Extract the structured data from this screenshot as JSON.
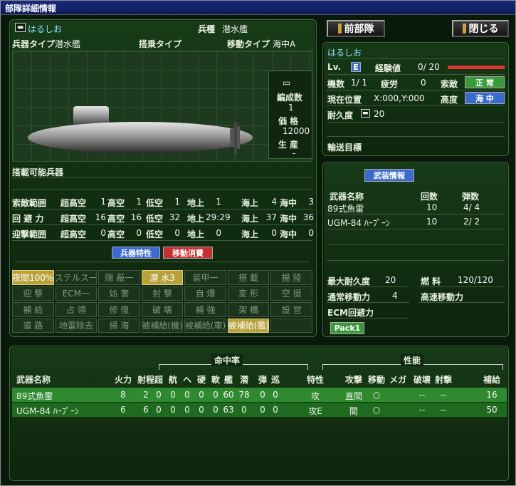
{
  "window": {
    "title": "部隊詳細情報"
  },
  "unit": {
    "name": "はるしお",
    "type_label": "兵種",
    "type_value": "潜水艦",
    "weapon_type_label": "兵器タイプ",
    "weapon_type_value": "潜水艦",
    "transport_label": "搭乗タイプ",
    "transport_value": "",
    "move_label": "移動タイプ",
    "move_value": "海中A"
  },
  "side": {
    "formation_label": "編成数",
    "formation_value": "1",
    "price_label": "価 格",
    "price_value": "12000",
    "produce_label": "生 産",
    "produce_value": "-"
  },
  "loadable": {
    "label": "搭載可能兵器"
  },
  "ranges": {
    "rows": [
      {
        "label": "索敵範囲",
        "v": [
          "1",
          "1",
          "1",
          "1",
          "4",
          "3"
        ]
      },
      {
        "label": "回 避 力",
        "v": [
          "16",
          "16",
          "32",
          "29:29",
          "37",
          "36"
        ]
      },
      {
        "label": "迎撃範囲",
        "v": [
          "0",
          "0",
          "0",
          "0",
          "0",
          "0"
        ]
      }
    ],
    "cols": [
      "超高空",
      "高空",
      "低空",
      "地上",
      "海上",
      "海中"
    ]
  },
  "tabs": {
    "traits": "兵器特性",
    "move_cost": "移動消費"
  },
  "traits": [
    "夜間100%",
    "ステルス一",
    "隠 蔽一",
    "潜 水3",
    "装甲一",
    "搭 載",
    "揚 陸",
    "迎 撃",
    "ECM一",
    "妨 害",
    "射 撃",
    "自 爆",
    "変 形",
    "空 挺",
    "補 給",
    "占 領",
    "修 復",
    "破 壊",
    "補 強",
    "架 橋",
    "設 営",
    "道 路",
    "地雷除去",
    "掃 海",
    "被補給(機)",
    "被補給(車)",
    "被補給(艦)",
    ""
  ],
  "buttons": {
    "prev": "前部隊",
    "close": "閉じる"
  },
  "status": {
    "name": "はるしお",
    "lv_label": "Lv.",
    "lv_value": "E",
    "exp_label": "経験値",
    "exp_value": "0/ 20",
    "units_label": "機数",
    "units_value": "1/ 1",
    "fatigue_label": "疲労",
    "fatigue_value": "0",
    "morale_label": "索敵",
    "morale_value": "正 常",
    "pos_label": "現在位置",
    "pos_value": "X:000,Y:000",
    "alt_label": "高度",
    "alt_value": "海 中",
    "hp_label": "耐久度",
    "hp_value": "20",
    "target_label": "輸送目標"
  },
  "arms": {
    "tab": "武装情報",
    "headers": [
      "武器名称",
      "回数",
      "弾数"
    ],
    "rows": [
      {
        "name": "89式魚雷",
        "count": "10",
        "ammo": "4/ 4"
      },
      {
        "name": "UGM-84 ﾊｰﾌﾟｰﾝ",
        "count": "10",
        "ammo": "2/ 2"
      }
    ],
    "max_hp_label": "最大耐久度",
    "max_hp_value": "20",
    "fuel_label": "燃 料",
    "fuel_value": "120/120",
    "move_label": "通常移動力",
    "move_value": "4",
    "fast_label": "高速移動力",
    "ecm_label": "ECM回避力",
    "pack": "Pack1"
  },
  "weapons_table": {
    "group_hit": "命中率",
    "group_perf": "性能",
    "headers": [
      "武器名称",
      "火力",
      "射程",
      "超",
      "航",
      "ヘ",
      "硬",
      "軟",
      "艦",
      "潜",
      "弾",
      "巡",
      "特性",
      "攻撃",
      "移動",
      "メガ",
      "破壊",
      "射撃",
      "補給"
    ],
    "rows": [
      [
        "89式魚雷",
        "8",
        "2",
        "0",
        "0",
        "0",
        "0",
        "0",
        "60",
        "78",
        "0",
        "0",
        "攻",
        "直間",
        "○",
        "",
        "--",
        "--",
        "16"
      ],
      [
        "UGM-84 ﾊｰﾌﾟｰﾝ",
        "6",
        "6",
        "0",
        "0",
        "0",
        "0",
        "0",
        "63",
        "0",
        "0",
        "0",
        "攻E",
        "間",
        "○",
        "",
        "--",
        "--",
        "50"
      ]
    ]
  },
  "colors": {
    "accent_green": "#3a9a3a",
    "alert_red": "#d33",
    "water_blue": "#3a6ad0"
  }
}
